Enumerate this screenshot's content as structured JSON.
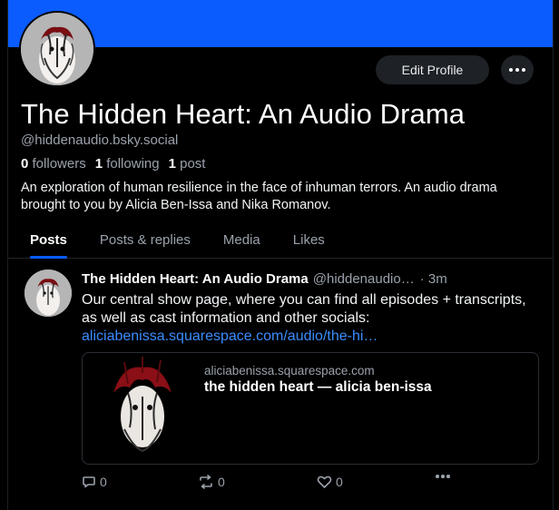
{
  "colors": {
    "banner": "#0a5cff",
    "link": "#3b8dff",
    "muted": "#9aa1ab",
    "background": "#000000"
  },
  "profile": {
    "display_name": "The Hidden Heart: An Audio Drama",
    "handle": "@hiddenaudio.bsky.social",
    "followers_count": "0",
    "followers_label": "followers",
    "following_count": "1",
    "following_label": "following",
    "posts_count": "1",
    "posts_label": "post",
    "bio": "An exploration of human resilience in the face of inhuman terrors. An audio drama brought to you by Alicia Ben-Issa and Nika Romanov.",
    "edit_button": "Edit Profile",
    "more_icon": "ellipsis-icon"
  },
  "tabs": [
    {
      "label": "Posts",
      "active": true
    },
    {
      "label": "Posts & replies",
      "active": false
    },
    {
      "label": "Media",
      "active": false
    },
    {
      "label": "Likes",
      "active": false
    }
  ],
  "post": {
    "author_name": "The Hidden Heart: An Audio Drama",
    "author_handle": "@hiddenaudio…",
    "time": "· 3m",
    "text": "Our central show page, where you can find all episodes + transcripts, as well as cast information and other socials:",
    "link_text": "aliciabenissa.squarespace.com/audio/the-hi…",
    "card": {
      "domain": "aliciabenissa.squarespace.com",
      "title": "the hidden heart — alicia ben-issa"
    },
    "actions": {
      "reply_count": "0",
      "repost_count": "0",
      "like_count": "0",
      "reply_icon": "reply-icon",
      "repost_icon": "repost-icon",
      "like_icon": "heart-icon",
      "more_icon": "ellipsis-icon"
    }
  }
}
